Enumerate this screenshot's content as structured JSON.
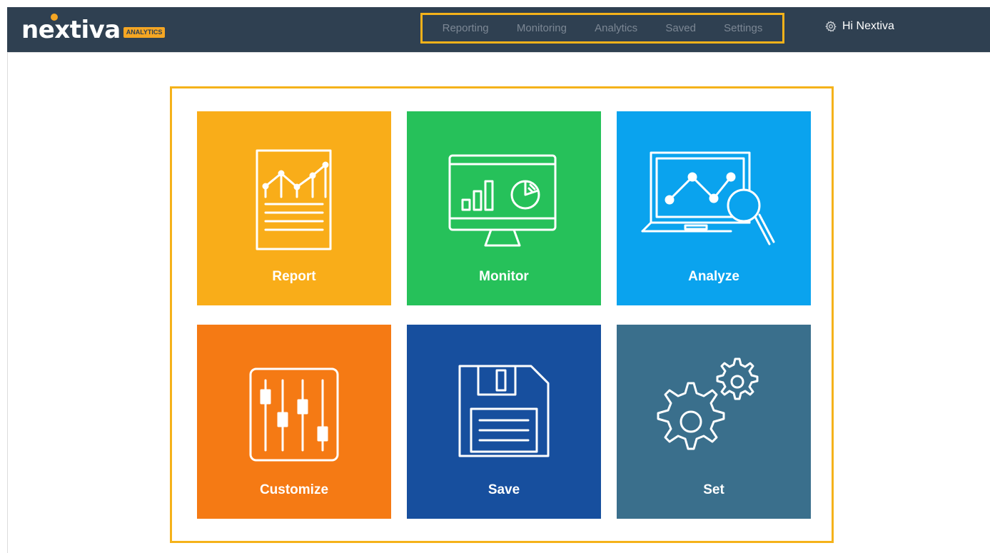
{
  "header": {
    "logo_text": "nextiva",
    "logo_badge": "ANALYTICS",
    "nav": [
      "Reporting",
      "Monitoring",
      "Analytics",
      "Saved",
      "Settings"
    ],
    "greeting": "Hi Nextiva"
  },
  "tiles": [
    {
      "label": "Report",
      "color": "#f9ad19",
      "icon": "report-chart-icon"
    },
    {
      "label": "Monitor",
      "color": "#26c15a",
      "icon": "monitor-icon"
    },
    {
      "label": "Analyze",
      "color": "#0aa3ee",
      "icon": "analyze-laptop-icon"
    },
    {
      "label": "Customize",
      "color": "#f57a14",
      "icon": "sliders-icon"
    },
    {
      "label": "Save",
      "color": "#174f9e",
      "icon": "floppy-disk-icon"
    },
    {
      "label": "Set",
      "color": "#3a6f8c",
      "icon": "gears-icon"
    }
  ],
  "colors": {
    "topbar": "#2f4051",
    "accent": "#f5b21a"
  }
}
